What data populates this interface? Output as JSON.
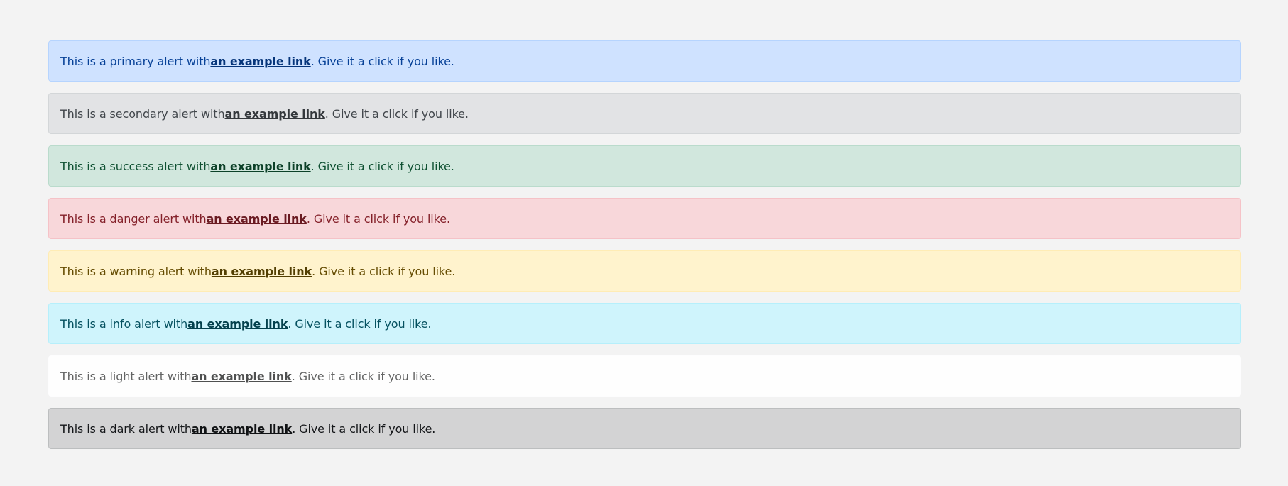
{
  "alerts": [
    {
      "id": "primary",
      "prefix": "This is a primary alert with ",
      "link": "an example link",
      "suffix": ". Give it a click if you like.",
      "bg": "#cfe2ff",
      "border": "#b6d4fe",
      "color": "#084298",
      "link_color": "#06357a"
    },
    {
      "id": "secondary",
      "prefix": "This is a secondary alert with ",
      "link": "an example link",
      "suffix": ". Give it a click if you like.",
      "bg": "#e2e3e5",
      "border": "#d3d6d8",
      "color": "#41464b",
      "link_color": "#34383c"
    },
    {
      "id": "success",
      "prefix": "This is a success alert with ",
      "link": "an example link",
      "suffix": ". Give it a click if you like.",
      "bg": "#d1e7dd",
      "border": "#badbcc",
      "color": "#0f5132",
      "link_color": "#0c4128"
    },
    {
      "id": "danger",
      "prefix": "This is a danger alert with ",
      "link": "an example link",
      "suffix": ". Give it a click if you like.",
      "bg": "#f8d7da",
      "border": "#f5c2c7",
      "color": "#842029",
      "link_color": "#6a1a21"
    },
    {
      "id": "warning",
      "prefix": "This is a warning alert with ",
      "link": "an example link",
      "suffix": ". Give it a click if you like.",
      "bg": "#fff3cd",
      "border": "#ffecb5",
      "color": "#664d03",
      "link_color": "#523e02"
    },
    {
      "id": "info",
      "prefix": "This is a info alert with ",
      "link": "an example link",
      "suffix": ". Give it a click if you like.",
      "bg": "#cff4fc",
      "border": "#b6effb",
      "color": "#055160",
      "link_color": "#04414d"
    },
    {
      "id": "light",
      "prefix": "This is a light alert with ",
      "link": "an example link",
      "suffix": ". Give it a click if you like.",
      "bg": "#fefefe",
      "border": "#fdfdfe",
      "color": "#636464",
      "link_color": "#4f5050"
    },
    {
      "id": "dark",
      "prefix": "This is a dark alert with ",
      "link": "an example link",
      "suffix": ". Give it a click if you like.",
      "bg": "#d3d3d4",
      "border": "#bcbebf",
      "color": "#141619",
      "link_color": "#101214"
    }
  ]
}
